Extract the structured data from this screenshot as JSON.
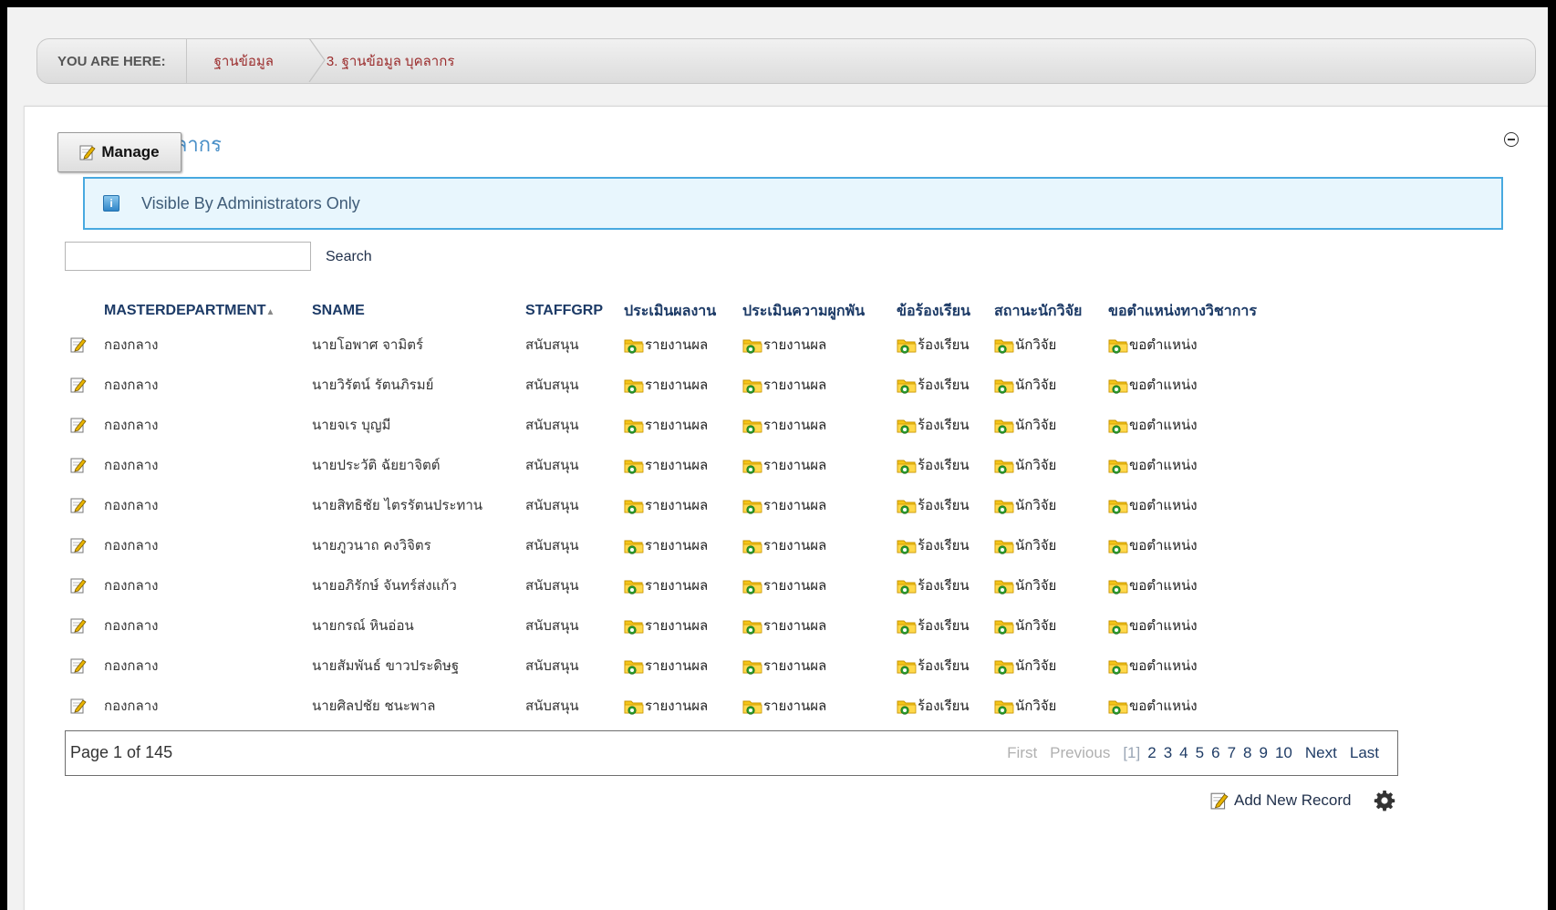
{
  "breadcrumb": {
    "label": "YOU ARE HERE:",
    "items": [
      "ฐานข้อมูล",
      "3. ฐานข้อมูล บุคลากร"
    ]
  },
  "module": {
    "title": "ข้อมูลบุคลากร",
    "manage_label": "Manage",
    "info_text": "Visible By Administrators Only"
  },
  "search": {
    "value": "",
    "button_label": "Search"
  },
  "grid": {
    "columns": [
      "MASTERDEPARTMENT",
      "SNAME",
      "STAFFGRP",
      "ประเมินผลงาน",
      "ประเมินความผูกพัน",
      "ข้อร้องเรียน",
      "สถานะนักวิจัย",
      "ขอตำแหน่งทางวิชาการ"
    ],
    "sort_indicator": "▲",
    "rows": [
      {
        "dept": "กองกลาง",
        "sname": "นายโอพาศ จามิตร์",
        "grp": "สนับสนุน",
        "eval": "รายงานผล",
        "eng": "รายงานผล",
        "req": "ร้องเรียน",
        "res": "นักวิจัย",
        "pos": "ขอตำแหน่ง"
      },
      {
        "dept": "กองกลาง",
        "sname": "นายวิรัตน์ รัตนภิรมย์",
        "grp": "สนับสนุน",
        "eval": "รายงานผล",
        "eng": "รายงานผล",
        "req": "ร้องเรียน",
        "res": "นักวิจัย",
        "pos": "ขอตำแหน่ง"
      },
      {
        "dept": "กองกลาง",
        "sname": "นายจเร บุญมี",
        "grp": "สนับสนุน",
        "eval": "รายงานผล",
        "eng": "รายงานผล",
        "req": "ร้องเรียน",
        "res": "นักวิจัย",
        "pos": "ขอตำแหน่ง"
      },
      {
        "dept": "กองกลาง",
        "sname": "นายประวัติ ฉัยยาจิตต์",
        "grp": "สนับสนุน",
        "eval": "รายงานผล",
        "eng": "รายงานผล",
        "req": "ร้องเรียน",
        "res": "นักวิจัย",
        "pos": "ขอตำแหน่ง"
      },
      {
        "dept": "กองกลาง",
        "sname": "นายสิทธิชัย ไตรรัตนประทาน",
        "grp": "สนับสนุน",
        "eval": "รายงานผล",
        "eng": "รายงานผล",
        "req": "ร้องเรียน",
        "res": "นักวิจัย",
        "pos": "ขอตำแหน่ง"
      },
      {
        "dept": "กองกลาง",
        "sname": "นายภูวนาถ คงวิจิตร",
        "grp": "สนับสนุน",
        "eval": "รายงานผล",
        "eng": "รายงานผล",
        "req": "ร้องเรียน",
        "res": "นักวิจัย",
        "pos": "ขอตำแหน่ง"
      },
      {
        "dept": "กองกลาง",
        "sname": "นายอภิรักษ์ จันทร์ส่งแก้ว",
        "grp": "สนับสนุน",
        "eval": "รายงานผล",
        "eng": "รายงานผล",
        "req": "ร้องเรียน",
        "res": "นักวิจัย",
        "pos": "ขอตำแหน่ง"
      },
      {
        "dept": "กองกลาง",
        "sname": "นายกรณ์ หินอ่อน",
        "grp": "สนับสนุน",
        "eval": "รายงานผล",
        "eng": "รายงานผล",
        "req": "ร้องเรียน",
        "res": "นักวิจัย",
        "pos": "ขอตำแหน่ง"
      },
      {
        "dept": "กองกลาง",
        "sname": "นายสัมพันธ์ ขาวประดิษฐ",
        "grp": "สนับสนุน",
        "eval": "รายงานผล",
        "eng": "รายงานผล",
        "req": "ร้องเรียน",
        "res": "นักวิจัย",
        "pos": "ขอตำแหน่ง"
      },
      {
        "dept": "กองกลาง",
        "sname": "นายศิลปชัย ชนะพาล",
        "grp": "สนับสนุน",
        "eval": "รายงานผล",
        "eng": "รายงานผล",
        "req": "ร้องเรียน",
        "res": "นักวิจัย",
        "pos": "ขอตำแหน่ง"
      }
    ]
  },
  "pager": {
    "info": "Page 1 of 145",
    "first": "First",
    "previous": "Previous",
    "current": "[1]",
    "pages": [
      "2",
      "3",
      "4",
      "5",
      "6",
      "7",
      "8",
      "9",
      "10"
    ],
    "next": "Next",
    "last": "Last"
  },
  "actions": {
    "add_record_label": "Add New Record"
  },
  "icons": {
    "edit": "pencil-edit-icon",
    "link": "folder-link-icon",
    "info": "info-icon",
    "collapse": "collapse-minus-icon",
    "settings": "gear-icon"
  },
  "colors": {
    "breadcrumb_link": "#9b2d2d",
    "header_text": "#1c3a66",
    "info_border": "#48a9e0",
    "info_bg": "#e8f6fd"
  }
}
